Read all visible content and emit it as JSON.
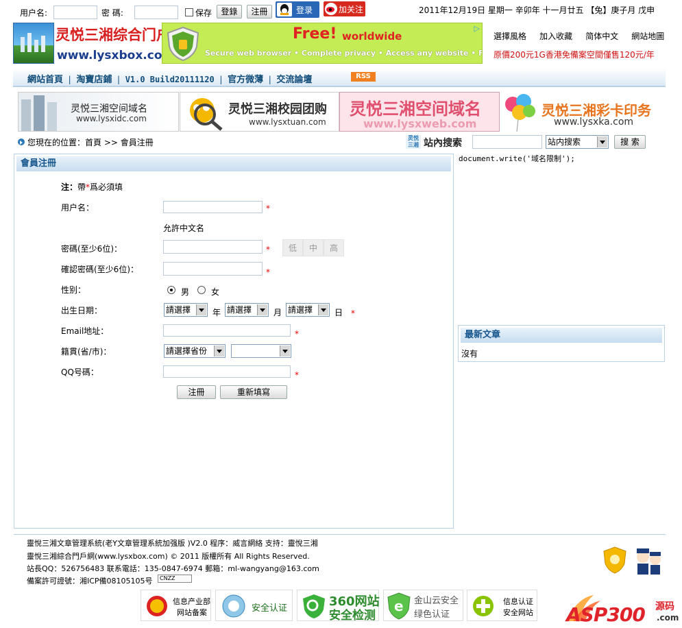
{
  "topbar": {
    "username_label": "用户名:",
    "password_label": "密  碼:",
    "save_label": "保存",
    "login_btn": "登錄",
    "register_btn": "注冊",
    "qq_login": "登录",
    "weibo_follow": "加关注",
    "date_text": "2011年12月19日 星期一  辛卯年 十一月廿五 【兔】庚子月 戊申"
  },
  "logo": {
    "title": "灵悦三湘综合门户网",
    "url": "www.lysxbox.com"
  },
  "ad_banner": {
    "free": "Free!",
    "worldwide": "worldwide",
    "features": "Secure web browser • Complete privacy • Access any website • Free VPN / Proxy",
    "ad_badge": "▷"
  },
  "header_links": {
    "items": [
      "選擇風格",
      "加入收藏",
      "简体中文",
      "網站地圖"
    ],
    "promo": "原價200元1G香港免備案空間僅售120元/年"
  },
  "nav": {
    "items": [
      "網站首頁",
      "淘寶店鋪",
      "V1.0 Build20111120",
      "官方微薄",
      "交流論壇"
    ],
    "rss": "RSS"
  },
  "banners": [
    {
      "title": "灵悦三湘空间域名",
      "url": "www.lysxidc.com"
    },
    {
      "title": "灵悦三湘校园团购",
      "url": "www.lysxtuan.com"
    },
    {
      "title": "灵悦三湘空间域名",
      "url": "www.lysxweb.com"
    },
    {
      "title": "灵悦三湘彩卡印务",
      "url": "www.lysxka.com"
    }
  ],
  "location": {
    "text": "您現在的位置：首頁 >> 會員注冊"
  },
  "search": {
    "label": "站內搜索",
    "select_value": "站内搜索",
    "button": "搜 索"
  },
  "right": {
    "script_text": "document.write('域名限制');",
    "latest_title": "最新文章",
    "latest_empty": "沒有"
  },
  "form": {
    "title": "會員注冊",
    "note_bold": "注：",
    "note_prefix": "帶",
    "note_star": "*",
    "note_suffix": "爲必須填",
    "username_label": "用户名：",
    "allow_chinese": "允許中文名",
    "password_label": "密碼(至少6位)：",
    "strength": [
      "低",
      "中",
      "高"
    ],
    "confirm_label": "確認密碼(至少6位)：",
    "gender_label": "性别：",
    "male": "男",
    "female": "女",
    "birth_label": "出生日期：",
    "select_placeholder": "請選擇",
    "year": "年",
    "month": "月",
    "day": "日",
    "email_label": "Email地址：",
    "native_label": "籍貫(省/市)：",
    "province_placeholder": "請選擇省份",
    "city_value": "",
    "qq_label": "QQ号碼：",
    "submit": "注冊",
    "reset": "重新填寫"
  },
  "footer": {
    "line1": "靈悅三湘文章管理系統(老Y文章管理系統加强版 )V2.0 程序：威言網絡 支持：靈悅三湘",
    "line2": "靈悅三湘綜合門戶網(www.lysxbox.com) © 2011 版權所有 All Rights Reserved.",
    "line3": "站長QQ：526756483 联系電話：135-0847-6974 郵箱：ml-wangyang@163.com",
    "line4": "備案許可證號：湘ICP備08105105号",
    "cnzz": "CNZZ",
    "badges": [
      {
        "l1": "信息产业部",
        "l2": "网站备案"
      },
      {
        "l1": "安全认证",
        "l2": ""
      },
      {
        "l1": "360网站",
        "l2": "安全检测"
      },
      {
        "l1": "金山云安全",
        "l2": "绿色认证"
      },
      {
        "l1": "信息认证",
        "l2": "安全网站"
      }
    ],
    "asp_logo": "ASP300",
    "asp_sub": "源码",
    "asp_com": ".com"
  },
  "colors": {
    "nav_text": "#124d7a",
    "required": "#ee0000",
    "panel_border": "#b9d1e6"
  }
}
